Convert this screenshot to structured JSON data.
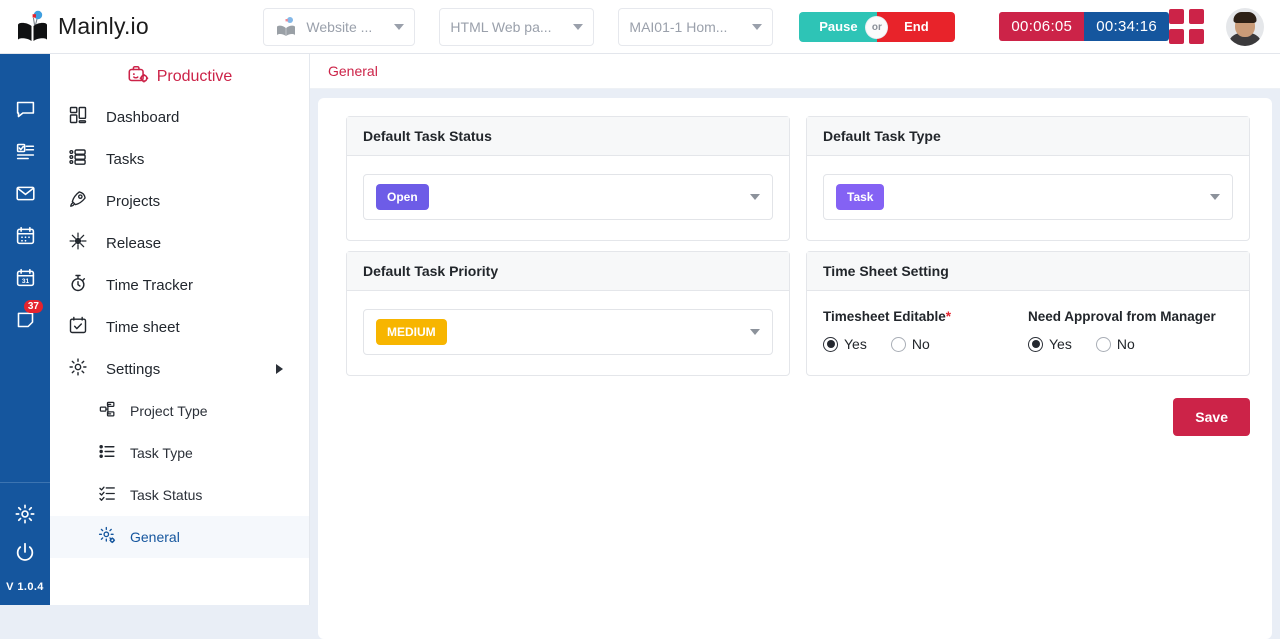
{
  "brand": {
    "name": "Mainly.io",
    "logo_icon": "book-balloon-logo"
  },
  "topbar": {
    "selectors": [
      {
        "name": "workspace-select",
        "value": "Website ...",
        "icon": "leaf-logo-icon"
      },
      {
        "name": "project-select",
        "value": "HTML Web pa..."
      },
      {
        "name": "task-select",
        "value": "MAI01-1 Hom..."
      }
    ],
    "pause_label": "Pause",
    "or_label": "or",
    "end_label": "End",
    "timer_session": "00:06:05",
    "timer_total": "00:34:16",
    "grid_icon": "apps-grid-icon",
    "avatar_icon": "user-avatar"
  },
  "rail": {
    "items": [
      {
        "name": "chat-icon",
        "badge": ""
      },
      {
        "name": "tasklist-icon",
        "badge": ""
      },
      {
        "name": "mail-icon",
        "badge": ""
      },
      {
        "name": "calendar-icon",
        "badge": ""
      },
      {
        "name": "calendar-date-icon",
        "badge": "37-holder"
      },
      {
        "name": "notes-icon",
        "badge": "37"
      }
    ],
    "settings_icon": "gear-icon",
    "power_icon": "power-icon",
    "version": "V 1.0.4"
  },
  "sidebar": {
    "title": "Productive",
    "title_icon": "briefcase-bot-icon",
    "items": [
      {
        "label": "Dashboard",
        "icon": "dashboard-icon"
      },
      {
        "label": "Tasks",
        "icon": "tasks-icon"
      },
      {
        "label": "Projects",
        "icon": "rocket-icon"
      },
      {
        "label": "Release",
        "icon": "release-icon"
      },
      {
        "label": "Time Tracker",
        "icon": "stopwatch-icon"
      },
      {
        "label": "Time sheet",
        "icon": "timesheet-icon"
      },
      {
        "label": "Settings",
        "icon": "gear-icon",
        "has_arrow": true
      }
    ],
    "sub_items": [
      {
        "label": "Project Type",
        "icon": "project-type-icon",
        "active": false
      },
      {
        "label": "Task Type",
        "icon": "list-icon",
        "active": false
      },
      {
        "label": "Task Status",
        "icon": "checklist-icon",
        "active": false
      },
      {
        "label": "General",
        "icon": "gear-settings-icon",
        "active": true
      }
    ]
  },
  "main": {
    "breadcrumb": "General",
    "cards": {
      "task_status": {
        "title": "Default Task Status",
        "value": "Open",
        "chip_color": "#6d5ce7"
      },
      "task_type": {
        "title": "Default Task Type",
        "value": "Task",
        "chip_color": "#8462f4"
      },
      "task_priority": {
        "title": "Default Task Priority",
        "value": "MEDIUM",
        "chip_color": "#f7b500"
      },
      "timesheet": {
        "title": "Time Sheet Setting",
        "editable_label": "Timesheet Editable",
        "editable_required": "*",
        "editable_yes": "Yes",
        "editable_no": "No",
        "editable_selected": "Yes",
        "approval_label": "Need Approval from Manager",
        "approval_yes": "Yes",
        "approval_no": "No",
        "approval_selected": "Yes"
      }
    },
    "save_label": "Save"
  },
  "colors": {
    "accent_crimson": "#cc2348",
    "rail_blue": "#15569e",
    "teal": "#2ec4b6",
    "red": "#e8232a"
  }
}
